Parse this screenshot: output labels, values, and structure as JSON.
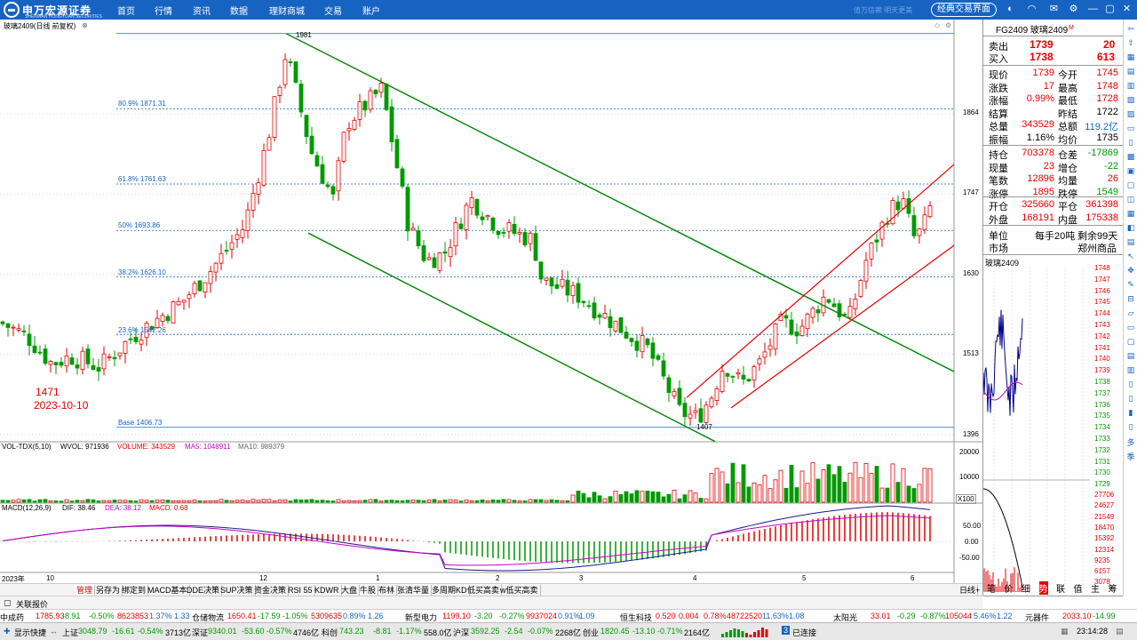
{
  "app": {
    "logo_text": "申万宏源证券",
    "logo_sub": "SHENWAN HONGYUAN SECURITIES",
    "nav": [
      "首页",
      "行情",
      "资讯",
      "数据",
      "理财商城",
      "交易",
      "账户"
    ],
    "slogan": "值万信赖 明天更美",
    "classic_btn": "经典交易界面"
  },
  "chart": {
    "title": "玻璃2409(日线 前复权)",
    "peak_label": "1981",
    "low_label": "1407",
    "fib": [
      "80.9% 1871.31",
      "61.8% 1761.63",
      "50% 1693.86",
      "38.2% 1626.10",
      "23.6% 1542.26",
      "Base 1406.73"
    ],
    "annot_price": "1471",
    "annot_date": "2023-10-10",
    "yticks": [
      "1864",
      "1747",
      "1630",
      "1513",
      "1396"
    ],
    "vol_title": "VOL-TDX(5,10)",
    "vol_wvol": "WVOL: 971936",
    "vol_volume": "VOLUME: 343529",
    "vol_ma5": "MA5: 1048911",
    "vol_ma10": "MA10: 989379",
    "vol_yticks": [
      "20000",
      "10000",
      "X100"
    ],
    "macd_title": "MACD(12,26,9)",
    "macd_dif": "DIF: 38.46",
    "macd_dea": "DEA: 38.12",
    "macd_val": "MACD: 0.68",
    "macd_yticks": [
      "50.00",
      "0.00",
      "-50.00"
    ],
    "xlabels": [
      "2023年",
      "10",
      "12",
      "1",
      "2",
      "3",
      "4",
      "5",
      "6"
    ]
  },
  "tabs": [
    "管理",
    "另存为",
    "绑定到",
    "MACD基本",
    "DDE决策",
    "SUP决策",
    "资金决策",
    "RSI 55",
    "KDWR",
    "大盘",
    "牛股",
    "布林",
    "张清华量",
    "多周期KD",
    "低买高卖",
    "w低买高卖"
  ],
  "tab_right": [
    "日线",
    "-",
    "+"
  ],
  "linked": "关联报价",
  "quote": {
    "code": "FG2409 玻璃2409",
    "sell_label": "卖出",
    "sell_price": "1739",
    "sell_vol": "20",
    "buy_label": "买入",
    "buy_price": "1738",
    "buy_vol": "613",
    "rows1": [
      [
        "现价",
        "1739",
        "今开",
        "1745"
      ],
      [
        "涨跌",
        "17",
        "最高",
        "1748"
      ],
      [
        "涨幅",
        "0.99%",
        "最低",
        "1728"
      ],
      [
        "结算",
        "",
        "昨结",
        "1722"
      ],
      [
        "总量",
        "343529",
        "总额",
        "119.2亿"
      ],
      [
        "振幅",
        "1.16%",
        "均价",
        "1735"
      ]
    ],
    "rows2": [
      [
        "持仓",
        "703378",
        "仓差",
        "-17869"
      ],
      [
        "现量",
        "23",
        "增仓",
        "-22"
      ],
      [
        "笔数",
        "12896",
        "均量",
        "26"
      ],
      [
        "涨停",
        "1895",
        "跌停",
        "1549"
      ]
    ],
    "rows3": [
      [
        "开仓",
        "325660",
        "平仓",
        "361398"
      ],
      [
        "外盘",
        "168191",
        "内盘",
        "175338"
      ]
    ],
    "unit_label": "单位",
    "unit_val": "每手20吨",
    "remain_label": "剩余99天",
    "market_label": "市场",
    "market_val": "郑州商品",
    "mini_title": "玻璃2409",
    "mini_prices": [
      "1748",
      "1747",
      "1746",
      "1745",
      "1744",
      "1743",
      "1742",
      "1741",
      "1740",
      "1739",
      "1738",
      "1737",
      "1736",
      "1735",
      "1734",
      "1733",
      "1732",
      "1731",
      "1730",
      "1729"
    ],
    "mini_vol": [
      "27706",
      "24627",
      "21549",
      "18470",
      "15392",
      "12314",
      "9235",
      "6157",
      "3078"
    ],
    "tabs": [
      "笔",
      "价",
      "细",
      "势",
      "联",
      "值",
      "主",
      "筹"
    ]
  },
  "side_icons": [
    "多",
    "季"
  ],
  "ticker1": [
    [
      "中成药",
      "1785.93",
      "-8.91",
      "-0.50%",
      "8623853",
      "1.37%",
      "1.33"
    ],
    [
      "仓储物流",
      "1650.41",
      "-17.59",
      "-1.05%",
      "5309635",
      "0.89%",
      "1.26"
    ],
    [
      "新型电力",
      "1199.10",
      "-3.20",
      "-0.27%",
      "9937024",
      "0.91%",
      "1.09"
    ],
    [
      "恒生科技",
      "0.520",
      "0.004",
      "0.78%",
      "48722520",
      "11.63%",
      "1.08"
    ],
    [
      "太阳光",
      "33.01",
      "-0.29",
      "-0.87%",
      "105044",
      "5.46%",
      "1.22"
    ],
    [
      "元器件",
      "2033.10",
      "-14.99",
      ""
    ]
  ],
  "ticker2": {
    "fast": "显示快捷",
    "sh_label": "上证",
    "sh": "3048.79",
    "sh_chg": "-16.61",
    "sh_pct": "-0.54%",
    "sh_amt": "3713亿",
    "sz_label": "深证",
    "sz": "9340.01",
    "sz_chg": "-53.60",
    "sz_pct": "-0.57%",
    "sz_amt": "4746亿",
    "kc_label": "科创",
    "kc": "743.23",
    "kc_chg": "-8.81",
    "kc_pct": "-1.17%",
    "kc_amt": "558.0亿",
    "hs_label": "沪深",
    "hs": "3592.25",
    "hs_chg": "-2.54",
    "hs_pct": "-0.07%",
    "hs_amt": "2268亿",
    "cy_label": "创业",
    "cy": "1820.45",
    "cy_chg": "-13.10",
    "cy_pct": "-0.71%",
    "cy_amt": "2164亿",
    "conn": "已连接",
    "time": "23:14:28"
  },
  "colors": {
    "up": "#e60000",
    "down": "#009900",
    "nav": "#1763c2"
  }
}
